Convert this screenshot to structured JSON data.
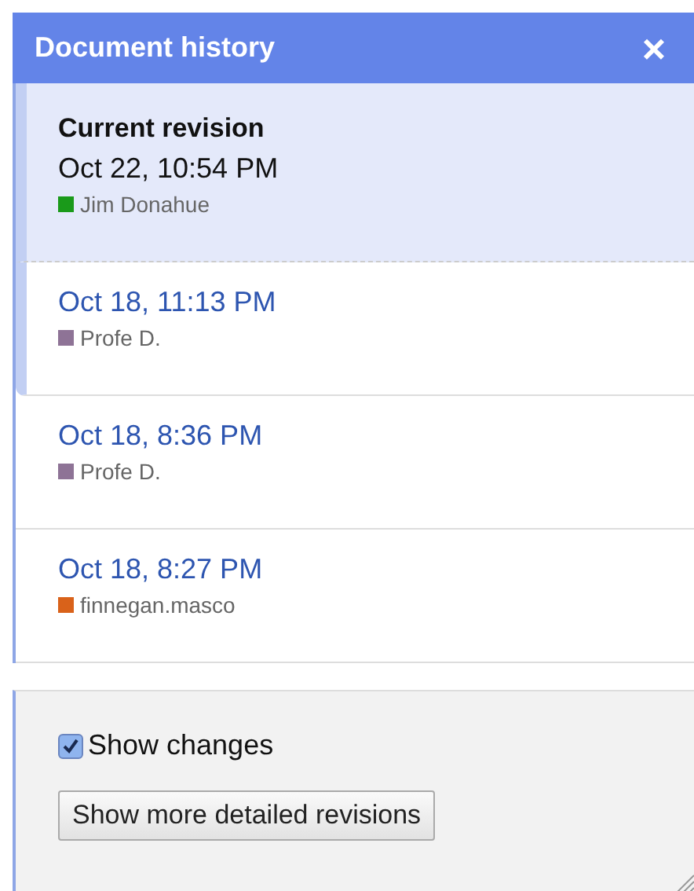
{
  "panel": {
    "title": "Document history",
    "close": "×"
  },
  "revisions": [
    {
      "heading": "Current revision",
      "date": "Oct 22, 10:54 PM",
      "author": "Jim Donahue",
      "color": "#1a9a1a",
      "selected": true
    },
    {
      "date": "Oct 18, 11:13 PM",
      "author": "Profe D.",
      "color": "#8e7396",
      "selected": false
    },
    {
      "date": "Oct 18, 8:36 PM",
      "author": "Profe D.",
      "color": "#8e7396",
      "selected": false
    },
    {
      "date": "Oct 18, 8:27 PM",
      "author": "finnegan.masco",
      "color": "#d9621a",
      "selected": false
    }
  ],
  "footer": {
    "show_changes": {
      "label": "Show changes",
      "checked": true
    },
    "button": "Show more detailed revisions"
  }
}
